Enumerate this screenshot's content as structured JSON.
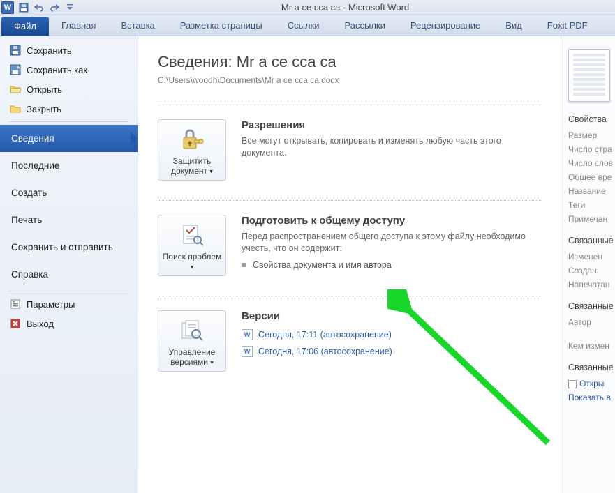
{
  "titlebar": {
    "doc_title": "Mr а се  сса са  -  Microsoft Word"
  },
  "ribbon": {
    "file_tab": "Файл",
    "tabs": [
      "Главная",
      "Вставка",
      "Разметка страницы",
      "Ссылки",
      "Рассылки",
      "Рецензирование",
      "Вид",
      "Foxit PDF"
    ]
  },
  "sidebar": {
    "save": "Сохранить",
    "save_as": "Сохранить как",
    "open": "Открыть",
    "close": "Закрыть",
    "info": "Сведения",
    "recent": "Последние",
    "new": "Создать",
    "print": "Печать",
    "share": "Сохранить и отправить",
    "help": "Справка",
    "options": "Параметры",
    "exit": "Выход"
  },
  "info": {
    "heading_prefix": "Сведения: ",
    "doc_name": "Mr а се  сса са",
    "path": "C:\\Users\\woodh\\Documents\\Mr а се  сса са.docx",
    "permissions": {
      "btn": "Защитить документ",
      "title": "Разрешения",
      "desc": "Все могут открывать, копировать и изменять любую часть этого документа."
    },
    "prepare": {
      "btn": "Поиск проблем",
      "title": "Подготовить к общему доступу",
      "desc": "Перед распространением общего доступа к этому файлу необходимо учесть, что он содержит:",
      "bullet1": "Свойства документа и имя автора"
    },
    "versions": {
      "btn": "Управление версиями",
      "title": "Версии",
      "items": [
        "Сегодня, 17:11 (автосохранение)",
        "Сегодня, 17:06 (автосохранение)"
      ]
    }
  },
  "props": {
    "heading": "Свойства",
    "size": "Размер",
    "pages": "Число стра",
    "words": "Число слов",
    "edit_time": "Общее вре",
    "title": "Название",
    "tags": "Теги",
    "comments": "Примечан",
    "related_dates": "Связанные",
    "modified": "Изменен",
    "created": "Создан",
    "printed": "Напечатан",
    "related_people": "Связанные",
    "author": "Автор",
    "last_modified_by": "Кем измен",
    "related_docs": "Связанные",
    "open_location": "Откры",
    "show_all": "Показать в"
  }
}
